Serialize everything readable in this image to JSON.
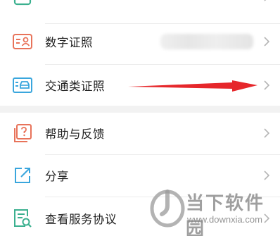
{
  "menu": {
    "items": [
      {
        "label": "数字证照",
        "icon": "id-card-icon",
        "color": "#e8735a"
      },
      {
        "label": "交通类证照",
        "icon": "car-license-icon",
        "color": "#3aa6dd"
      },
      {
        "label": "帮助与反馈",
        "icon": "help-feedback-icon",
        "color": "#e8735a"
      },
      {
        "label": "分享",
        "icon": "share-icon",
        "color": "#3aa6dd"
      },
      {
        "label": "查看服务协议",
        "icon": "agreement-icon",
        "color": "#3bb08f"
      }
    ]
  },
  "overlay": {
    "arrow_color": "#e6272b"
  },
  "watermark": {
    "cn": "当下软件园",
    "en": "www.downxia.com"
  }
}
